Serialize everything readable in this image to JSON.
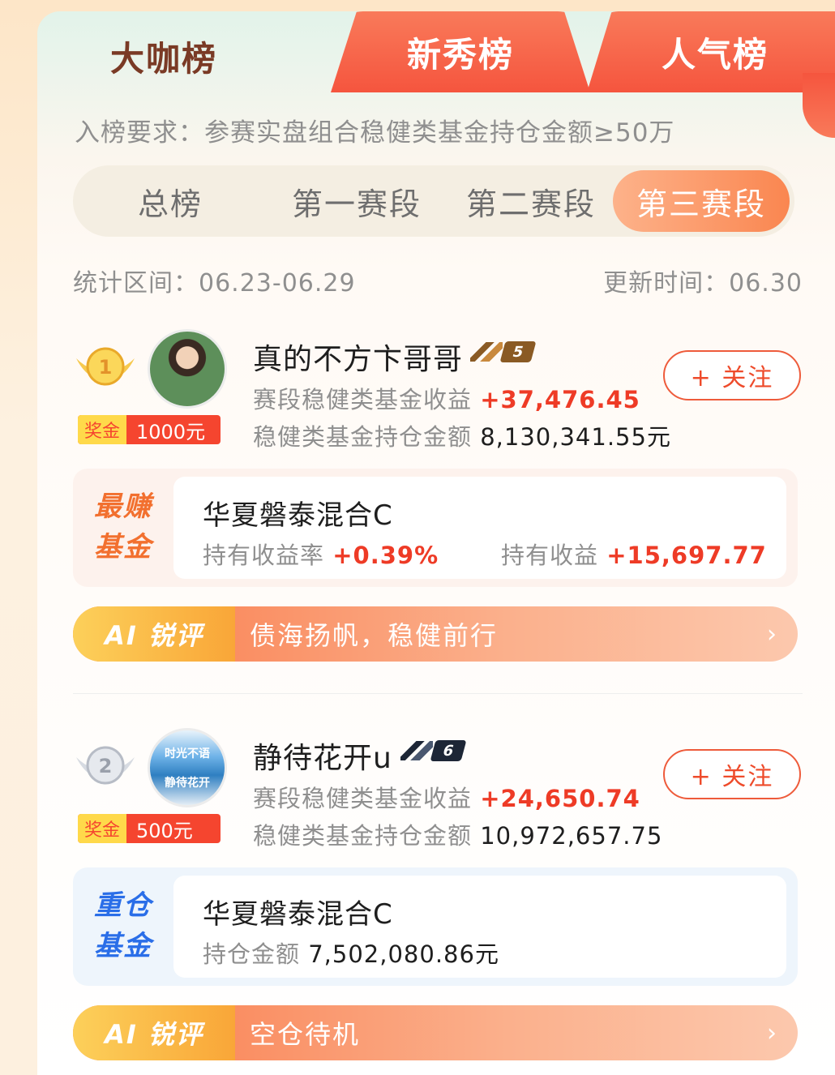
{
  "tabs": [
    {
      "label": "大咖榜",
      "active": true
    },
    {
      "label": "新秀榜",
      "active": false
    },
    {
      "label": "人气榜",
      "active": false
    }
  ],
  "requirement": "入榜要求：参赛实盘组合稳健类基金持仓金额≥50万",
  "segments": [
    {
      "label": "总榜",
      "active": false
    },
    {
      "label": "第一赛段",
      "active": false
    },
    {
      "label": "第二赛段",
      "active": false
    },
    {
      "label": "第三赛段",
      "active": true
    }
  ],
  "stat_range": "统计区间：06.23-06.29",
  "update_time": "更新时间：06.30",
  "follow_label": "+ 关注",
  "colors": {
    "accent": "#f5553e",
    "profit_red": "#ee3b26",
    "segment_active": "#fa8650"
  },
  "entries": [
    {
      "rank": "1",
      "medal_icon": "gold-medal-icon",
      "name": "真的不方卞哥哥",
      "level": "5",
      "prize_label": "奖金",
      "prize_value": "1000元",
      "segment_profit_label": "赛段稳健类基金收益",
      "segment_profit": "+37,476.45",
      "holding_label": "稳健类基金持仓金额",
      "holding_value": "8,130,341.55元",
      "fund_tag": "最赚基金",
      "fund_name": "华夏磐泰混合C",
      "fund_stat1_label": "持有收益率",
      "fund_stat1_value": "+0.39%",
      "fund_stat2_label": "持有收益",
      "fund_stat2_value": "+15,697.77",
      "ai_badge": "AI 锐评",
      "ai_comment": "债海扬帆，稳健前行"
    },
    {
      "rank": "2",
      "medal_icon": "silver-medal-icon",
      "name": "静待花开u",
      "level": "6",
      "avatar_text_1": "时光不语",
      "avatar_text_2": "静待花开",
      "prize_label": "奖金",
      "prize_value": "500元",
      "segment_profit_label": "赛段稳健类基金收益",
      "segment_profit": "+24,650.74",
      "holding_label": "稳健类基金持仓金额",
      "holding_value": "10,972,657.75",
      "fund_tag": "重仓基金",
      "fund_name": "华夏磐泰混合C",
      "fund_stat1_label": "持仓金额",
      "fund_stat1_value": "7,502,080.86元",
      "ai_badge": "AI 锐评",
      "ai_comment": "空仓待机"
    }
  ]
}
